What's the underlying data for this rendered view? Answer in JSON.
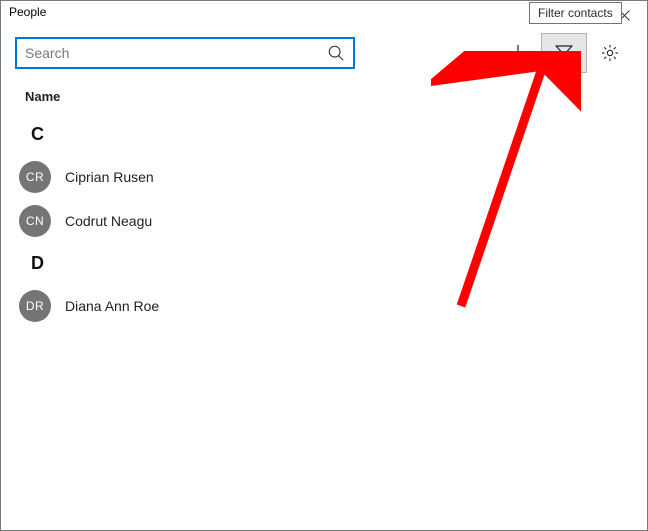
{
  "window": {
    "title": "People"
  },
  "tooltip": {
    "text": "Filter contacts"
  },
  "search": {
    "placeholder": "Search"
  },
  "list": {
    "header": "Name"
  },
  "sections": [
    {
      "letter": "C",
      "contacts": [
        {
          "initials": "CR",
          "name": "Ciprian Rusen"
        },
        {
          "initials": "CN",
          "name": "Codrut Neagu"
        }
      ]
    },
    {
      "letter": "D",
      "contacts": [
        {
          "initials": "DR",
          "name": "Diana Ann Roe"
        }
      ]
    }
  ]
}
